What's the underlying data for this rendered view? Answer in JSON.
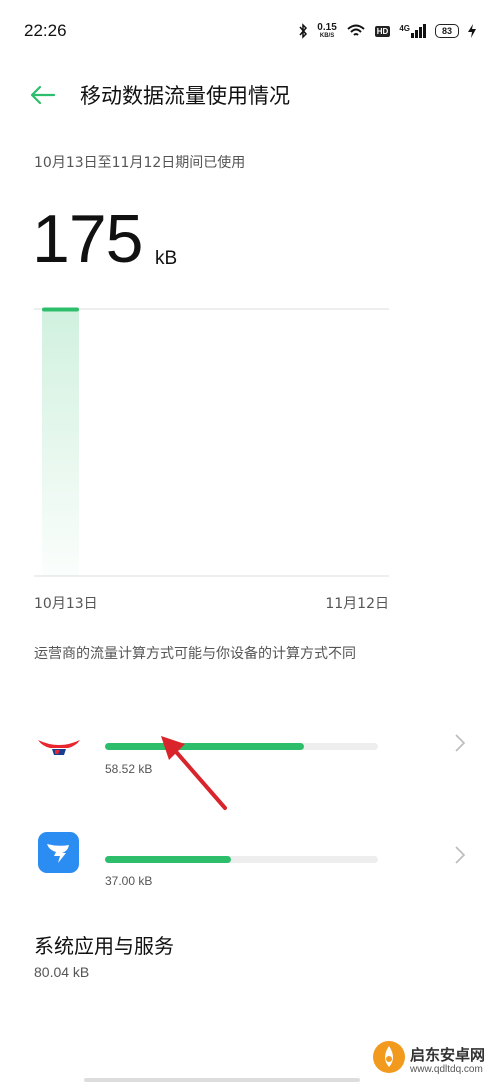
{
  "status_bar": {
    "time": "22:26",
    "net_speed_value": "0.15",
    "net_speed_unit": "KB/S",
    "hd_label": "HD",
    "network_label": "4G",
    "battery_level": "83"
  },
  "header": {
    "title": "移动数据流量使用情况",
    "accent_color": "#2dbe6c"
  },
  "summary": {
    "period": "10月13日至11月12日期间已使用",
    "total_value": "175",
    "total_unit": "kB"
  },
  "chart_data": {
    "type": "bar",
    "x_start_label": "10月13日",
    "x_end_label": "11月12日",
    "categories": [
      "10月13日"
    ],
    "values": [
      175
    ],
    "unit": "kB",
    "bar_color": "#2dbe6c"
  },
  "carrier_note": "运营商的流量计算方式可能与你设备的计算方式不同",
  "apps": [
    {
      "icon": "red-app-icon",
      "usage": "58.52 kB",
      "fraction": 0.73
    },
    {
      "icon": "dingtalk-icon",
      "usage": "37.00 kB",
      "fraction": 0.46
    }
  ],
  "system": {
    "title": "系统应用与服务",
    "usage": "80.04 kB"
  },
  "watermark": {
    "name": "启东安卓网",
    "url": "www.qdltdq.com"
  }
}
